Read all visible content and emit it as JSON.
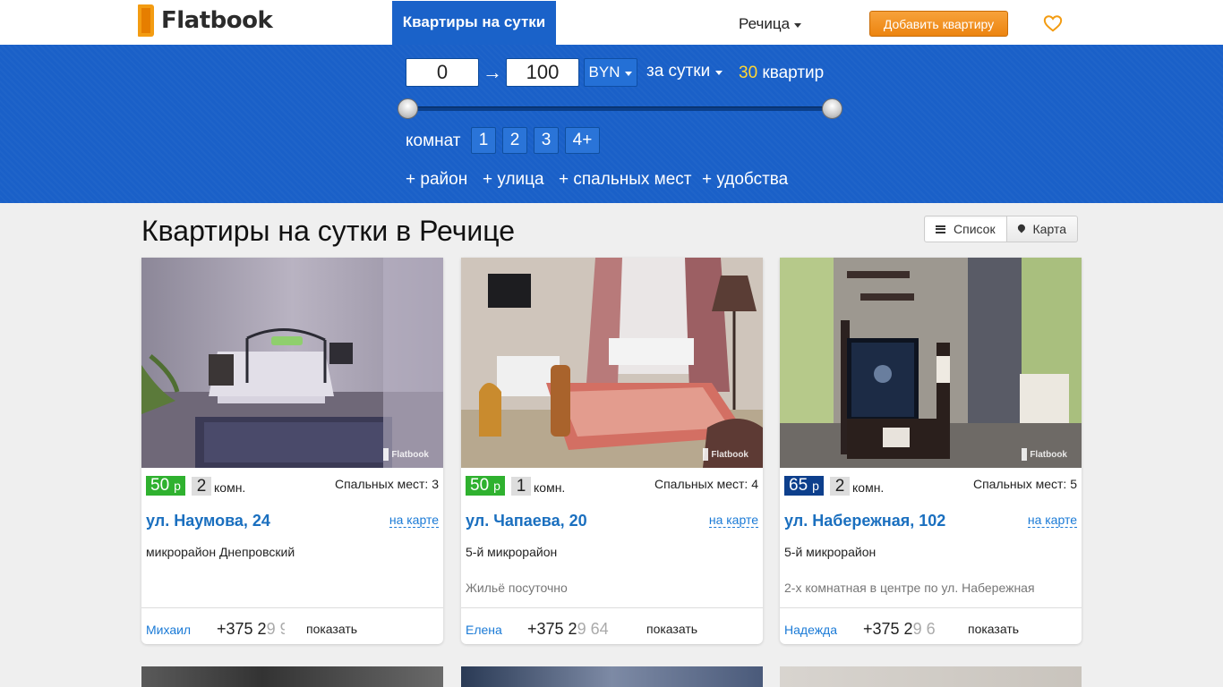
{
  "header": {
    "logo_text": "Flatbook",
    "nav_active": "Квартиры на сутки",
    "city": "Речица",
    "add_button": "Добавить квартиру"
  },
  "filter": {
    "price_from": "0",
    "price_to": "100",
    "arrow": "→",
    "currency": "BYN",
    "period": "за сутки",
    "count_num": "30",
    "count_label": "квартир",
    "price_range": {
      "min": 0,
      "max": 100,
      "selected_from": 0,
      "selected_to": 100
    },
    "rooms_label": "комнат",
    "rooms": [
      "1",
      "2",
      "3",
      "4+"
    ],
    "more": [
      "+ район",
      "+ улица",
      "+ спальных мест",
      "+ удобства"
    ]
  },
  "page": {
    "title": "Квартиры на сутки в Речице",
    "view_list": "Список",
    "view_map": "Карта"
  },
  "listings": [
    {
      "price": "50",
      "unit": "р",
      "price_color": "#2fb12f",
      "rooms": "2",
      "rooms_unit": "комн.",
      "beds": "Спальных мест: 3",
      "address": "ул. Наумова, 24",
      "on_map": "на карте",
      "district": "микрорайон Днепровский",
      "description": "",
      "owner": "Михаил",
      "phone_visible": "+375 2",
      "phone_faded": "9 9",
      "show": "показать",
      "watermark": "Flatbook"
    },
    {
      "price": "50",
      "unit": "р",
      "price_color": "#2fb12f",
      "rooms": "1",
      "rooms_unit": "комн.",
      "beds": "Спальных мест: 4",
      "address": "ул. Чапаева, 20",
      "on_map": "на карте",
      "district": "5-й микрорайон",
      "description": "Жильё посуточно",
      "owner": "Елена",
      "phone_visible": "+375 2",
      "phone_faded": "9 64",
      "show": "показать",
      "watermark": "Flatbook"
    },
    {
      "price": "65",
      "unit": "р",
      "price_color": "#0d3f8c",
      "rooms": "2",
      "rooms_unit": "комн.",
      "beds": "Спальных мест: 5",
      "address": "ул. Набережная, 102",
      "on_map": "на карте",
      "district": "5-й микрорайон",
      "description": "2-х комнатная в центре по ул. Набережная",
      "owner": "Надежда",
      "phone_visible": "+375 2",
      "phone_faded": "9 6",
      "show": "показать",
      "watermark": "Flatbook"
    }
  ],
  "colors": {
    "accent_blue": "#1a60c8",
    "orange": "#ec8410",
    "price_green": "#2fb12f",
    "price_dark_blue": "#0d3f8c",
    "link_blue": "#1a7ad6"
  }
}
